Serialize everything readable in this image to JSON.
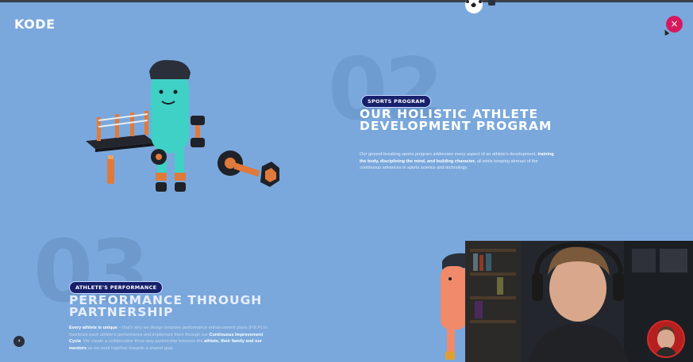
{
  "brand": {
    "logo": "KODE"
  },
  "header": {
    "close_icon": "×"
  },
  "section_1": {
    "number": "02",
    "tag": "SPORTS PROGRAM",
    "title": "OUR HOLISTIC ATHLETE DEVELOPMENT PROGRAM",
    "text_1": "Our ground-breaking sports program addresses every aspect of an athlete's development,",
    "text_bold": "training the body, disciplining the mind, and building character,",
    "text_2": "all while keeping abreast of the continuous advances in sports science and technology."
  },
  "section_2": {
    "number": "03",
    "tag": "ATHLETE'S PERFORMANCE",
    "title": "PERFORMANCE THROUGH PARTNERSHIP",
    "text_a": "Every athlete is unique",
    "text_b": " – that's why we design bespoke performance enhancement plans (P.E.P) to maximize each athlete's performance and implement them through our ",
    "text_c": "Continuous Improvement Cycle",
    "text_d": ". We create a collaborative three way partnership between the ",
    "text_e": "athlete, their family and our mentors",
    "text_f": " as we work together towards a shared goal."
  },
  "controls": {
    "sound_icon": "◖"
  },
  "colors": {
    "background": "#7aa8dc",
    "accent": "#d6195e",
    "pill": "#17206b",
    "character": "#3fd1c5"
  },
  "icons": [
    "close-icon",
    "sound-icon",
    "soccer-ball-icon"
  ]
}
